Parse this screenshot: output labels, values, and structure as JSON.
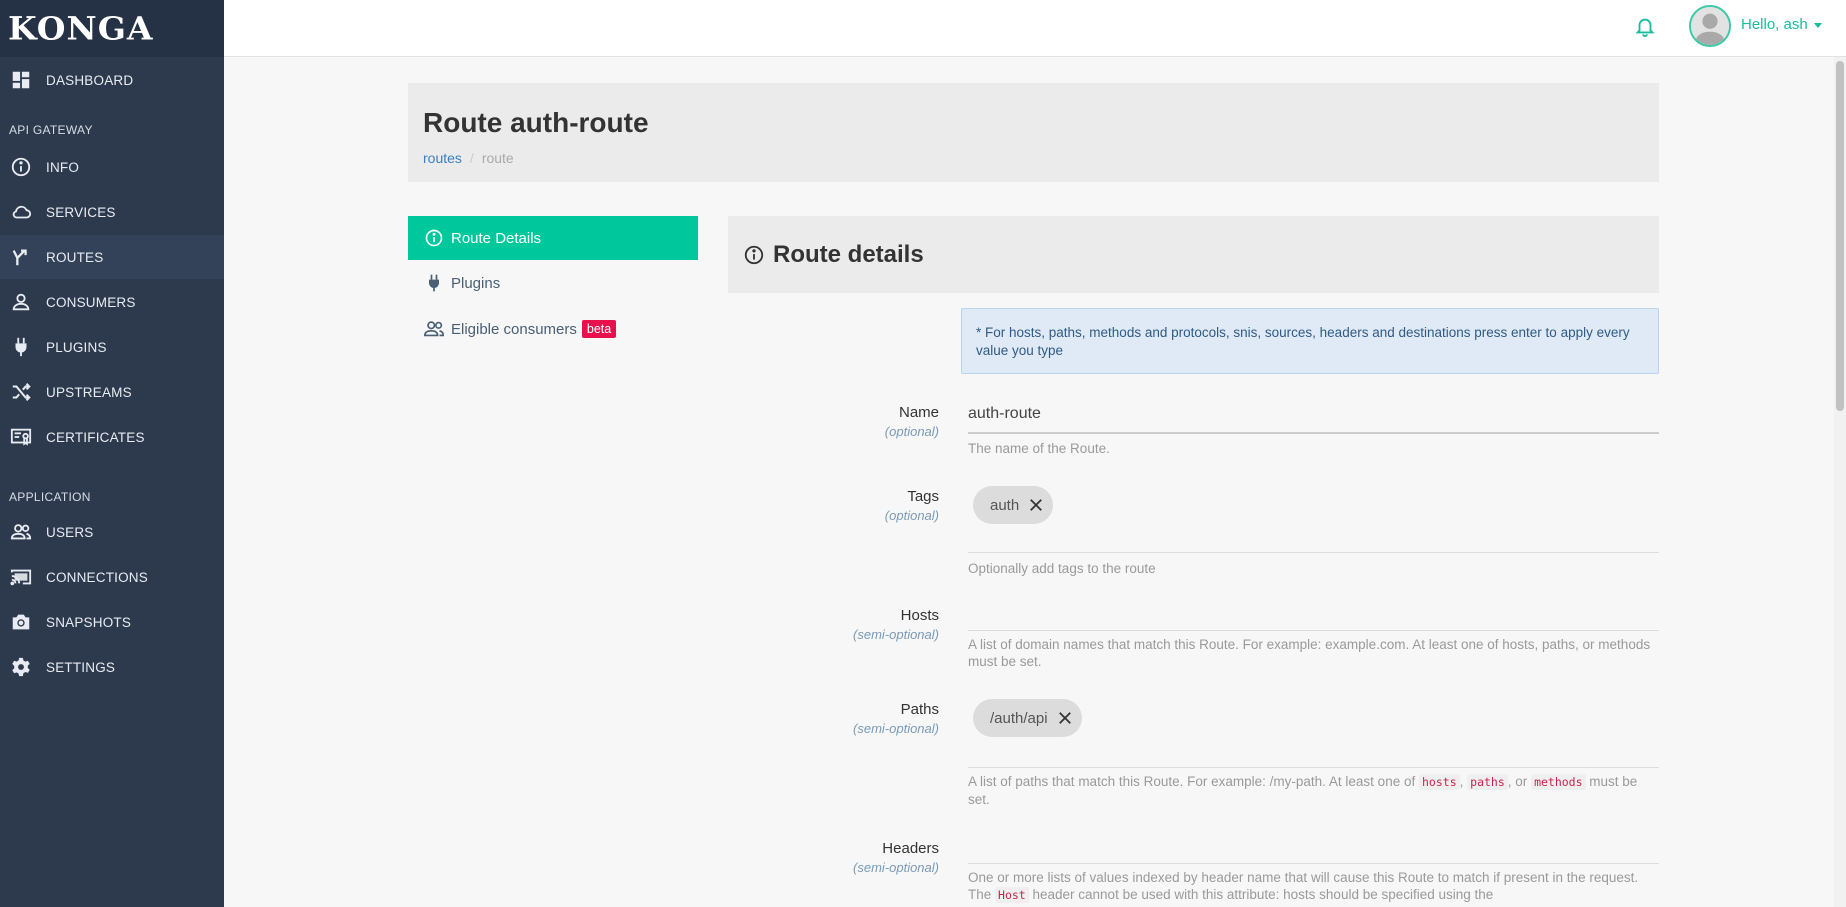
{
  "app": {
    "logo": "KONGA"
  },
  "sidebar": {
    "items": [
      {
        "label": "DASHBOARD",
        "icon": "dashboard-icon"
      },
      {
        "label": "INFO",
        "icon": "info-icon"
      },
      {
        "label": "SERVICES",
        "icon": "cloud-icon"
      },
      {
        "label": "ROUTES",
        "icon": "routes-icon",
        "active": true
      },
      {
        "label": "CONSUMERS",
        "icon": "user-icon"
      },
      {
        "label": "PLUGINS",
        "icon": "plug-icon"
      },
      {
        "label": "UPSTREAMS",
        "icon": "shuffle-icon"
      },
      {
        "label": "CERTIFICATES",
        "icon": "certificate-icon"
      },
      {
        "label": "USERS",
        "icon": "users-icon"
      },
      {
        "label": "CONNECTIONS",
        "icon": "cast-icon"
      },
      {
        "label": "SNAPSHOTS",
        "icon": "camera-icon"
      },
      {
        "label": "SETTINGS",
        "icon": "gear-icon"
      }
    ],
    "sections": {
      "api_gateway": "API GATEWAY",
      "application": "APPLICATION"
    }
  },
  "topbar": {
    "greeting": "Hello, ash"
  },
  "page": {
    "title": "Route auth-route",
    "breadcrumb": {
      "link": "routes",
      "separator": "/",
      "current": "route"
    }
  },
  "tabs": {
    "route_details": "Route Details",
    "plugins": "Plugins",
    "eligible_consumers": "Eligible consumers",
    "beta": "beta"
  },
  "panel": {
    "title": "Route details",
    "alert": "* For hosts, paths, methods and protocols, snis, sources, headers and destinations press enter to apply every value you type"
  },
  "fields": {
    "name": {
      "label": "Name",
      "optional": "(optional)",
      "value": "auth-route",
      "help": "The name of the Route."
    },
    "tags": {
      "label": "Tags",
      "optional": "(optional)",
      "chips": [
        "auth"
      ],
      "help": "Optionally add tags to the route"
    },
    "hosts": {
      "label": "Hosts",
      "optional": "(semi-optional)",
      "help": "A list of domain names that match this Route. For example: example.com. At least one of hosts, paths, or methods must be set."
    },
    "paths": {
      "label": "Paths",
      "optional": "(semi-optional)",
      "chips": [
        "/auth/api"
      ],
      "help_a": "A list of paths that match this Route. For example: /my-path. At least one of",
      "code_hosts": "hosts",
      "comma": ",",
      "code_paths": "paths",
      "or": ", or",
      "code_methods": "methods",
      "help_b": "must be set."
    },
    "headers": {
      "label": "Headers",
      "optional": "(semi-optional)",
      "help_a": "One or more lists of values indexed by header name that will cause this Route to match if present in the request. The",
      "code_host": "Host",
      "help_b": "header cannot be used with this attribute: hosts should be specified using the"
    }
  },
  "colors": {
    "sidebar": "#2d3a4e",
    "accent": "#00c89d",
    "beta": "#e8114d",
    "link": "#3a7fc3"
  }
}
